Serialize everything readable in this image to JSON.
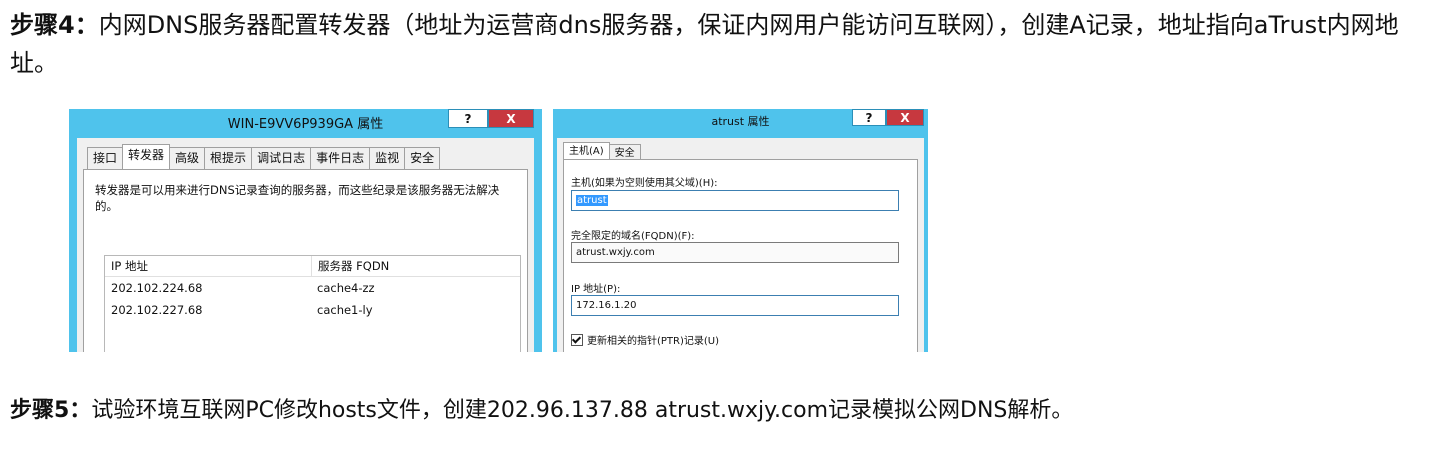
{
  "step4": {
    "label": "步骤4：",
    "text": "内网DNS服务器配置转发器（地址为运营商dns服务器，保证内网用户能访问互联网），创建A记录，地址指向aTrust内网地址。"
  },
  "step5": {
    "label": "步骤5：",
    "text": "试验环境互联网PC修改hosts文件，创建202.96.137.88 atrust.wxjy.com记录模拟公网DNS解析。"
  },
  "dialog1": {
    "title": "WIN-E9VV6P939GA 属性",
    "help": "?",
    "close": "X",
    "tabs": [
      "接口",
      "转发器",
      "高级",
      "根提示",
      "调试日志",
      "事件日志",
      "监视",
      "安全"
    ],
    "active_tab": 1,
    "description": "转发器是可以用来进行DNS记录查询的服务器，而这些纪录是该服务器无法解决的。",
    "columns": [
      "IP 地址",
      "服务器 FQDN"
    ],
    "rows": [
      [
        "202.102.224.68",
        "cache4-zz"
      ],
      [
        "202.102.227.68",
        "cache1-ly"
      ]
    ]
  },
  "dialog2": {
    "title": "atrust 属性",
    "help": "?",
    "close": "X",
    "tabs": [
      "主机(A)",
      "安全"
    ],
    "host_label": "主机(如果为空则使用其父域)(H):",
    "host_value": "atrust",
    "fqdn_label": "完全限定的域名(FQDN)(F):",
    "fqdn_value": "atrust.wxjy.com",
    "ip_label": "IP 地址(P):",
    "ip_value": "172.16.1.20",
    "ptr_label": "更新相关的指针(PTR)记录(U)",
    "ptr_checked": true
  }
}
